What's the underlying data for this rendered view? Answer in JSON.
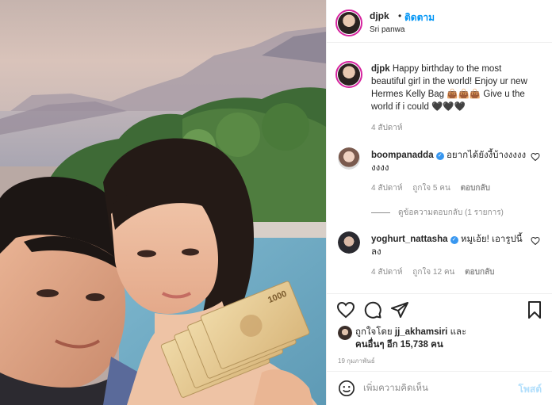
{
  "post": {
    "username": "djpk",
    "separator": "•",
    "follow_label": "ติดตาม",
    "location": "Sri panwa",
    "photo_banknote_text": "1000"
  },
  "caption": {
    "username": "djpk",
    "text": "Happy birthday to the most beautiful girl in the world! Enjoy ur new Hermes Kelly Bag 👜👜👜 Give u the world if i could 🖤🖤🖤",
    "time": "4 สัปดาห์"
  },
  "comments": [
    {
      "username": "boompanadda",
      "text": "อยากได้ยังงี้บ้างงงงงงงงง",
      "time": "4 สัปดาห์",
      "likes": "ถูกใจ 5 คน",
      "reply_label": "ตอบกลับ",
      "view_replies": "ดูข้อความตอบกลับ (1 รายการ)"
    },
    {
      "username": "yoghurt_nattasha",
      "text": "หมูเอ้ย! เอารูปนี้ลง",
      "time": "4 สัปดาห์",
      "likes": "ถูกใจ 12 คน",
      "reply_label": "ตอบกลับ"
    }
  ],
  "likes": {
    "prefix": "ถูกใจโดย",
    "first_user": "jj_akhamsiri",
    "and": "และ",
    "others": "คนอื่นๆ อีก 15,738 คน"
  },
  "date": "19 กุมภาพันธ์",
  "add_comment": {
    "placeholder": "เพิ่มความคิดเห็น",
    "post_label": "โพสต์"
  },
  "icons": {
    "like": "heart-icon",
    "comment": "comment-icon",
    "share": "paper-plane-icon",
    "save": "bookmark-icon",
    "emoji": "emoji-icon",
    "verified": "verified-badge-icon"
  },
  "colors": {
    "link_blue": "#0095f6",
    "post_disabled": "#b2dffc",
    "verified": "#3897f0",
    "muted": "#8e8e8e"
  }
}
